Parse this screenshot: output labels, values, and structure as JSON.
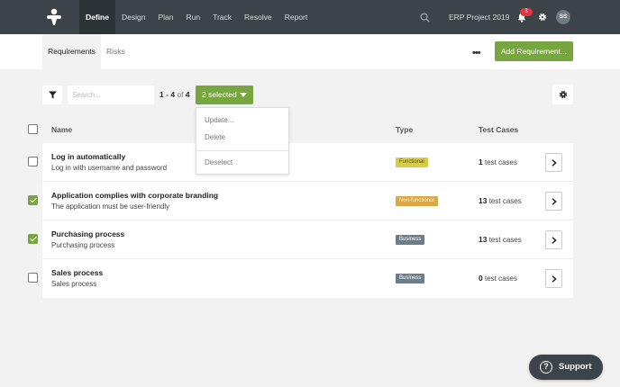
{
  "colors": {
    "nav_bg": "#3c4449",
    "accent": "#77a53f",
    "badge_red": "#e0383e",
    "functional": "#d9cc45",
    "nonfunctional": "#dca845",
    "business": "#6f7d86"
  },
  "nav": {
    "logo_icon": "plus-cross-logo",
    "items": [
      {
        "label": "Define",
        "active": true
      },
      {
        "label": "Design"
      },
      {
        "label": "Plan"
      },
      {
        "label": "Run"
      },
      {
        "label": "Track"
      },
      {
        "label": "Resolve"
      },
      {
        "label": "Report"
      }
    ],
    "project": "ERP Project 2019",
    "notifications": "3",
    "avatar": "SS"
  },
  "tabs": {
    "requirements": "Requirements",
    "risks": "Risks"
  },
  "more": "•••",
  "add_button": "Add Requirement...",
  "toolbar": {
    "search_placeholder": "Search...",
    "pager": {
      "from": "1",
      "dash": "-",
      "to": "4",
      "of": "of",
      "total": "4"
    },
    "selected": "2 selected"
  },
  "dropdown": {
    "update": "Update...",
    "delete": "Delete",
    "deselect": "Deselect"
  },
  "table": {
    "headers": {
      "name": "Name",
      "type": "Type",
      "test_cases": "Test Cases"
    },
    "rows": [
      {
        "title": "Log in automatically",
        "subtitle": "Log in with username and password",
        "type": "Functional",
        "count": "1",
        "unit": "test cases",
        "checked": false
      },
      {
        "title": "Application complies with corporate branding",
        "subtitle": "The application must be user-friendly",
        "type": "Non-functional",
        "count": "13",
        "unit": "test cases",
        "checked": true
      },
      {
        "title": "Purchasing process",
        "subtitle": "Purchasing process",
        "type": "Business",
        "count": "13",
        "unit": "test cases",
        "checked": true
      },
      {
        "title": "Sales process",
        "subtitle": "Sales process",
        "type": "Business",
        "count": "0",
        "unit": "test cases",
        "checked": false
      }
    ]
  },
  "support": {
    "icon": "?",
    "label": "Support"
  }
}
